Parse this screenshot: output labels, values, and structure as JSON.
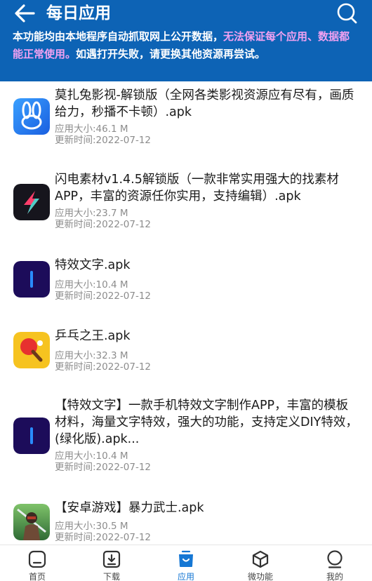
{
  "header": {
    "title": "每日应用",
    "notice_normal_1": "本功能均由本地程序自动抓取网上公开数据，",
    "notice_warn": "无法保证每个应用、数据都能正常使用。",
    "notice_normal_2": "如遇打开失败，请更换其他资源再尝试。"
  },
  "apps": [
    {
      "title": "莫扎兔影视-解锁版（全网各类影视资源应有尽有，画质给力，秒播不卡顿）.apk",
      "size": "应用大小:46.1 M",
      "updated": "更新时间:2022-07-12",
      "icon": "rabbit-app-icon"
    },
    {
      "title": "闪电素材v1.4.5解锁版（一款非常实用强大的找素材APP，丰富的资源任你实用，支持编辑）.apk",
      "size": "应用大小:23.7 M",
      "updated": "更新时间:2022-07-12",
      "icon": "lightning-app-icon"
    },
    {
      "title": "特效文字.apk",
      "size": "应用大小:10.4 M",
      "updated": "更新时间:2022-07-12",
      "icon": "effect-text-app-icon"
    },
    {
      "title": "乒乓之王.apk",
      "size": "应用大小:32.3 M",
      "updated": "更新时间:2022-07-12",
      "icon": "ping-pong-app-icon"
    },
    {
      "title": "【特效文字】一款手机特效文字制作APP，丰富的模板材料，海量文字特效，强大的功能，支持定义DIY特效，(绿化版).apk...",
      "size": "应用大小:10.4 M",
      "updated": "更新时间:2022-07-12",
      "icon": "effect-text-app-icon"
    },
    {
      "title": "【安卓游戏】暴力武士.apk",
      "size": "应用大小:30.5 M",
      "updated": "更新时间:2022-07-12",
      "icon": "samurai-game-icon"
    }
  ],
  "nav": [
    {
      "label": "首页",
      "icon": "home-icon",
      "active": false
    },
    {
      "label": "下载",
      "icon": "download-icon",
      "active": false
    },
    {
      "label": "应用",
      "icon": "bag-icon",
      "active": true
    },
    {
      "label": "微功能",
      "icon": "cube-icon",
      "active": false
    },
    {
      "label": "我的",
      "icon": "user-icon",
      "active": false
    }
  ],
  "colors": {
    "header_bg": "#0d63b5",
    "warn_text": "#f1a1f1",
    "nav_active": "#1577d4"
  }
}
